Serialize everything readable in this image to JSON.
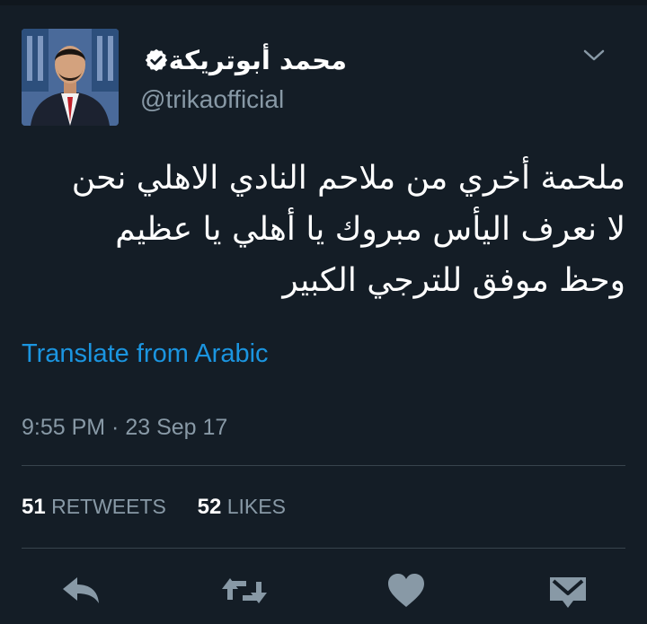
{
  "tweet": {
    "author_name": "محمد أبوتريكة",
    "handle": "@trikaofficial",
    "text_lines": [
      "ملحمة أخري من ملاحم النادي الاهلي نحن",
      "لا نعرف اليأس مبروك يا أهلي يا عظيم",
      "وحظ موفق للترجي الكبير"
    ],
    "translate_label": "Translate from Arabic",
    "timestamp": "9:55 PM · 23 Sep 17",
    "retweets_count": "51",
    "retweets_label": "RETWEETS",
    "likes_count": "52",
    "likes_label": "LIKES"
  },
  "icons": [
    "verified-badge-icon",
    "chevron-down-icon",
    "reply-icon",
    "retweet-icon",
    "heart-icon",
    "direct-message-icon"
  ],
  "colors": {
    "background": "#141d26",
    "primary_text": "#ffffff",
    "secondary_text": "#8899a6",
    "link": "#1b95e0",
    "divider": "#38444d",
    "action_icon": "#8899a6"
  }
}
